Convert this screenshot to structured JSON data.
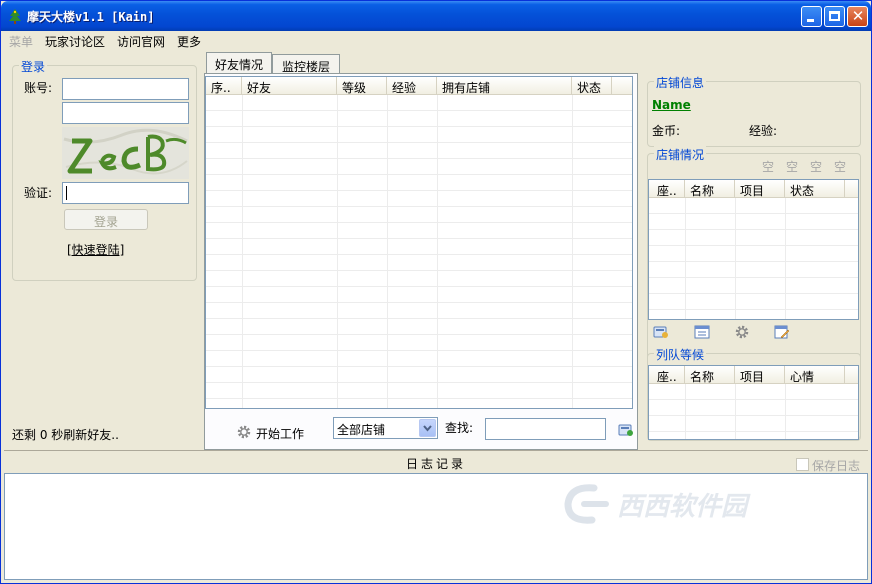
{
  "window": {
    "title": "摩天大楼v1.1  [Kain]"
  },
  "menu": [
    {
      "label": "菜单",
      "disabled": true
    },
    {
      "label": "玩家讨论区",
      "disabled": false
    },
    {
      "label": "访问官网",
      "disabled": false
    },
    {
      "label": "更多",
      "disabled": false
    }
  ],
  "login": {
    "group_title": "登录",
    "account_label": "账号:",
    "account_value": "",
    "password_value": "",
    "captcha_text": "ZecB",
    "verify_label": "验证:",
    "verify_value": "",
    "login_button": "登录",
    "quick_login_link": "[快速登陆]"
  },
  "status_text": "还剩 0 秒刷新好友..",
  "tabs": [
    {
      "label": "好友情况",
      "active": true
    },
    {
      "label": "监控楼层",
      "active": false
    }
  ],
  "friends_table": {
    "columns": [
      "序..",
      "好友",
      "等级",
      "经验",
      "拥有店铺",
      "状态"
    ],
    "rows": []
  },
  "controls": {
    "start_work": "开始工作",
    "shop_filter_value": "全部店铺",
    "search_label": "查找:",
    "search_value": ""
  },
  "shop_info": {
    "group_title": "店铺信息",
    "name": "Name",
    "gold_label": "金币:",
    "exp_label": "经验:"
  },
  "shop_status": {
    "group_title": "店铺情况",
    "slots": [
      "空",
      "空",
      "空",
      "空"
    ],
    "columns": [
      "座..",
      "名称",
      "项目",
      "状态"
    ],
    "rows": []
  },
  "queue": {
    "group_title": "列队等候",
    "columns": [
      "座..",
      "名称",
      "项目",
      "心情"
    ],
    "rows": []
  },
  "log": {
    "title": "日志记录",
    "save_log_label": "保存日志",
    "watermark": "西西软件园"
  },
  "colors": {
    "accent": "#0046d5",
    "titlebar": "#0451d8",
    "shop_name": "#008000"
  }
}
